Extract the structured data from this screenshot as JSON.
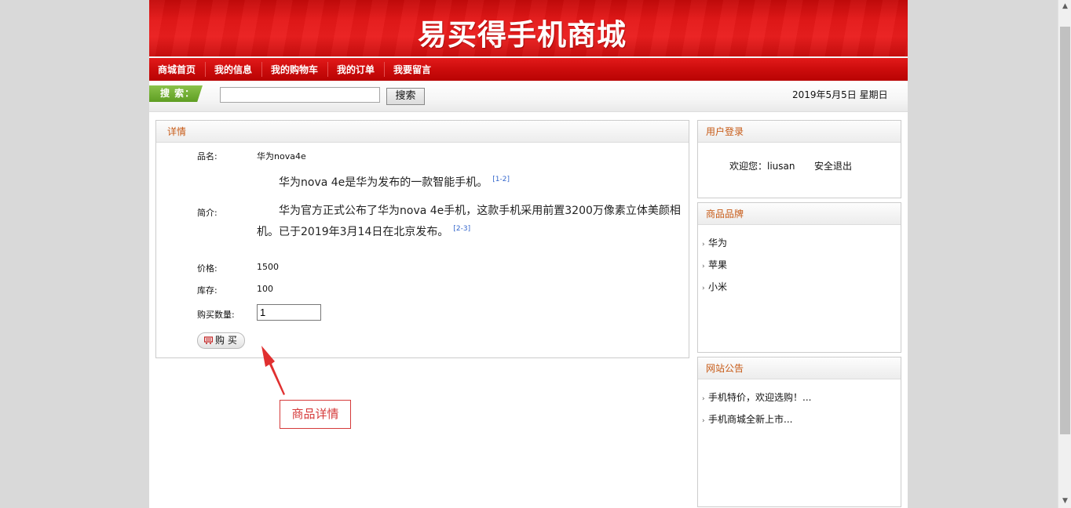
{
  "header": {
    "title": "易买得手机商城"
  },
  "nav": {
    "items": [
      "商城首页",
      "我的信息",
      "我的购物车",
      "我的订单",
      "我要留言"
    ]
  },
  "search": {
    "label": "搜 索：",
    "value": "",
    "button": "搜索",
    "date": "2019年5月5日  星期日"
  },
  "detail": {
    "title": "详情",
    "name_label": "品名:",
    "name": "华为nova4e",
    "intro_line1": "华为nova 4e是华为发布的一款智能手机。",
    "intro_ref1": "[1-2]",
    "intro_label": "简介:",
    "intro_line2": "华为官方正式公布了华为nova 4e手机，这款手机采用前置3200万像素立体美颜相机。已于2019年3月14日在北京发布。",
    "intro_ref2": "[2-3]",
    "price_label": "价格:",
    "price": "1500",
    "stock_label": "库存:",
    "stock": "100",
    "qty_label": "购买数量:",
    "qty": "1",
    "buy_button": "购 买"
  },
  "annotation": {
    "text": "商品详情",
    "color": "#d53a3a"
  },
  "login": {
    "title": "用户登录",
    "welcome": "欢迎您：liusan",
    "logout": "安全退出"
  },
  "brands": {
    "title": "商品品牌",
    "items": [
      "华为",
      "苹果",
      "小米"
    ]
  },
  "notices": {
    "title": "网站公告",
    "items": [
      "手机特价，欢迎选购！...",
      "手机商城全新上市..."
    ]
  },
  "colors": {
    "brand_red": "#e41818",
    "panel_title": "#c75a16",
    "search_green": "#6aa82e"
  }
}
